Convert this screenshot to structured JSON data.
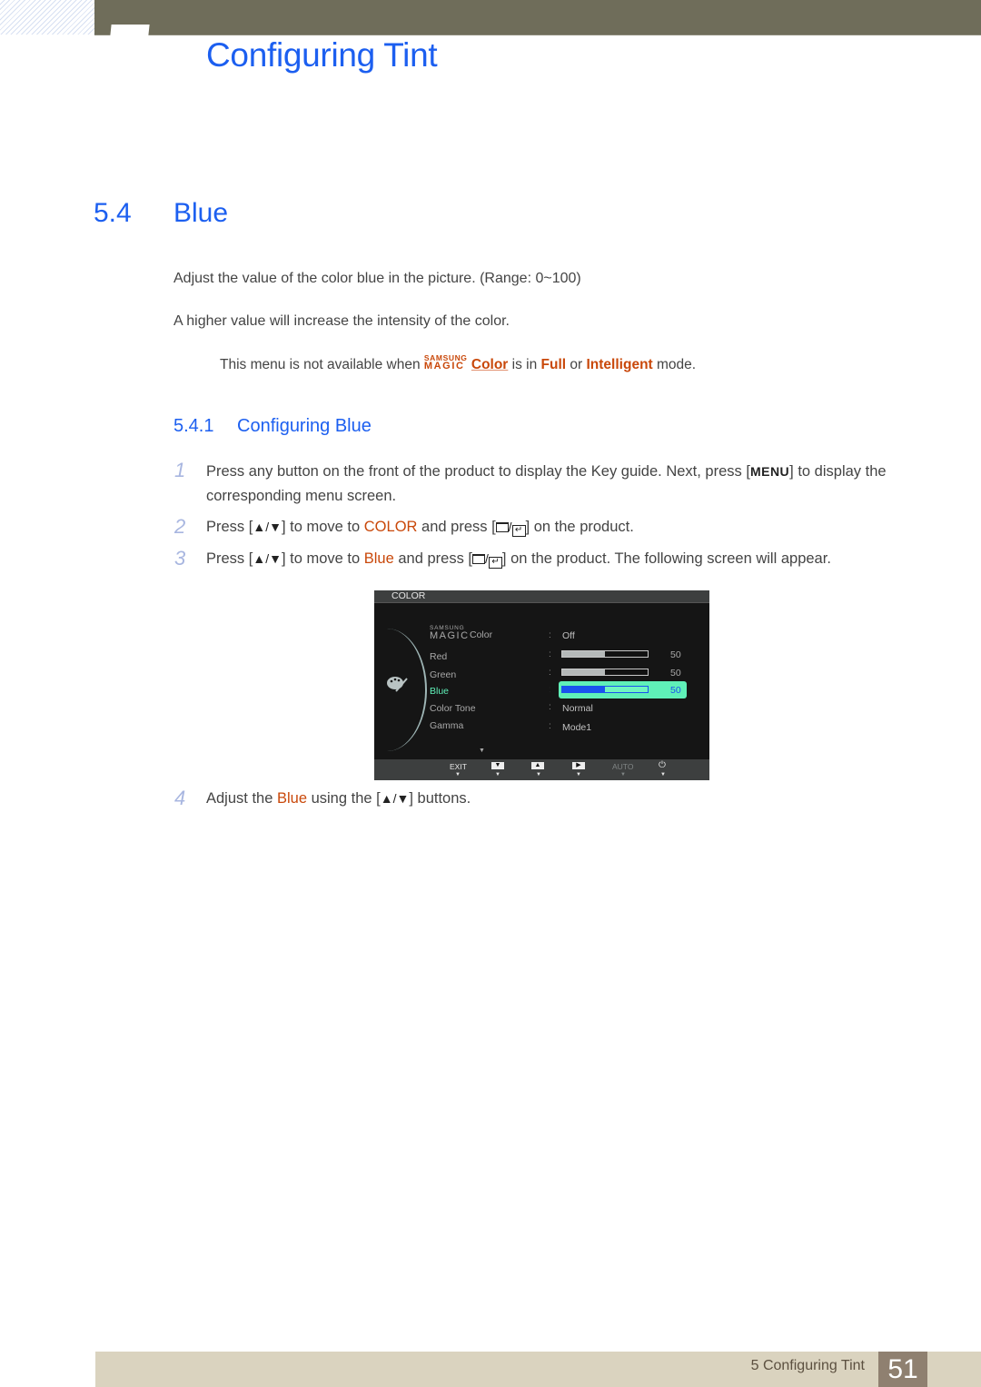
{
  "header": {
    "chapter_title": "Configuring Tint"
  },
  "section": {
    "number": "5.4",
    "title": "Blue",
    "paragraphs": [
      "Adjust the value of the color blue in the picture. (Range: 0~100)",
      "A higher value will increase the intensity of the color."
    ],
    "note": {
      "prefix": "This menu is not available when ",
      "logo_top": "SAMSUNG",
      "logo_bottom": "MAGIC",
      "logo_word": "Color",
      "middle": " is in ",
      "mode1": "Full",
      "or": " or ",
      "mode2": "Intelligent",
      "suffix": " mode."
    }
  },
  "subsection": {
    "number": "5.4.1",
    "title": "Configuring Blue"
  },
  "steps": [
    {
      "num": "1",
      "a": "Press any button on the front of the product to display the Key guide. Next, press [",
      "key": "MENU",
      "b": "] to display the corresponding menu screen."
    },
    {
      "num": "2",
      "a": "Press [",
      "arrows": "▲/▼",
      "b": "] to move to ",
      "target": "COLOR",
      "c": " and press [",
      "d": "] on the product."
    },
    {
      "num": "3",
      "a": "Press [",
      "arrows": "▲/▼",
      "b": "] to move to ",
      "target": "Blue",
      "c": " and press [",
      "d": "] on the product. The following screen will appear."
    },
    {
      "num": "4",
      "a": "Adjust the ",
      "target": "Blue",
      "b": " using the [",
      "arrows": "▲/▼",
      "c": "] buttons."
    }
  ],
  "osd": {
    "title": "COLOR",
    "magic_top": "SAMSUNG",
    "magic_bottom": "MAGIC",
    "magic_word": "Color",
    "colon": ":",
    "rows": [
      {
        "label": "Red",
        "value": "50",
        "level": 0.5
      },
      {
        "label": "Green",
        "value": "50",
        "level": 0.5
      },
      {
        "label": "Blue",
        "value": "50",
        "level": 0.5,
        "selected": true
      },
      {
        "label": "Color Tone",
        "value": "Normal"
      },
      {
        "label": "Gamma",
        "value": "Mode1"
      }
    ],
    "magic_value": "Off",
    "more_indicator": "▼",
    "footer_keys": {
      "exit": "EXIT",
      "down": "▼",
      "up": "▲",
      "right": "▶",
      "auto": "AUTO",
      "power": "⏻"
    },
    "pointer": "▼",
    "colors": {
      "selected_bg": "#5ff0b8",
      "selected_text": "#5ff0b8",
      "selected_bar": "#1a53ee"
    }
  },
  "footer": {
    "chapter_label": "5 Configuring Tint",
    "page_number": "51"
  }
}
